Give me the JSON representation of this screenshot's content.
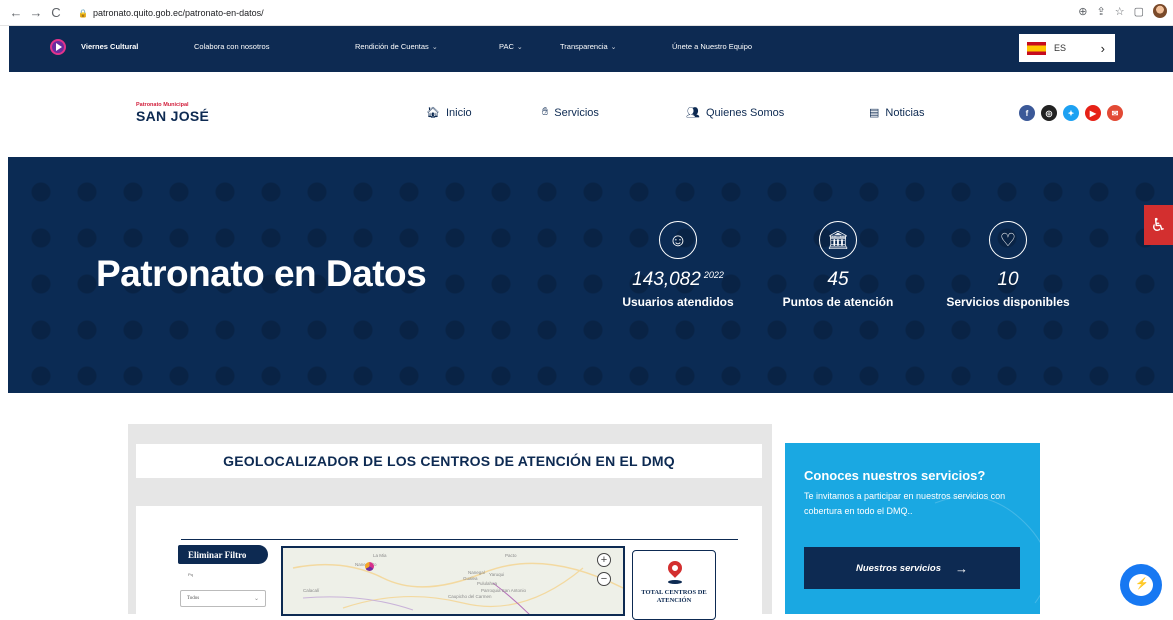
{
  "browser": {
    "url": "patronato.quito.gob.ec/patronato-en-datos/"
  },
  "topbar": {
    "items": [
      {
        "label": "Viernes Cultural"
      },
      {
        "label": "Colabora con nosotros"
      },
      {
        "label": "Rendición de Cuentas"
      },
      {
        "label": "PAC"
      },
      {
        "label": "Transparencia"
      },
      {
        "label": "Únete a Nuestro Equipo"
      }
    ],
    "language": {
      "code": "ES"
    }
  },
  "header": {
    "logo_small": "Patronato Municipal",
    "logo_big": "SAN JOSÉ",
    "nav": [
      {
        "label": "Inicio",
        "icon": "home-icon"
      },
      {
        "label": "Servicios",
        "icon": "hand-icon"
      },
      {
        "label": "Quienes Somos",
        "icon": "users-icon"
      },
      {
        "label": "Noticias",
        "icon": "newspaper-icon"
      }
    ],
    "social": [
      {
        "name": "facebook-icon",
        "glyph": "f",
        "color": "#3b5998"
      },
      {
        "name": "instagram-icon",
        "glyph": "◎",
        "color": "#222222"
      },
      {
        "name": "twitter-icon",
        "glyph": "✦",
        "color": "#1da1f2"
      },
      {
        "name": "youtube-icon",
        "glyph": "▶",
        "color": "#e62117"
      },
      {
        "name": "email-icon",
        "glyph": "✉",
        "color": "#e24a35"
      }
    ]
  },
  "hero": {
    "title": "Patronato en Datos",
    "stats": [
      {
        "value": "143,082",
        "suffix": "2022",
        "label": "Usuarios atendidos",
        "icon": "users-outline-icon"
      },
      {
        "value": "45",
        "suffix": "",
        "label": "Puntos de atención",
        "icon": "building-icon"
      },
      {
        "value": "10",
        "suffix": "",
        "label": "Servicios disponibles",
        "icon": "heart-icon"
      }
    ]
  },
  "geo": {
    "title": "GEOLOCALIZADOR DE LOS CENTROS DE ATENCIÓN EN EL DMQ",
    "filter_button": "Eliminar Filtro",
    "select_label": "Pq",
    "select_value": "Todos",
    "map_labels": [
      "La Mia",
      "Nanegalito",
      "Pacto",
      "Nanegal",
      "Yaruqui",
      "Gualea",
      "Pululahua",
      "Pululahua",
      "Parroquia San Antonio",
      "Calacalí",
      "Caupicho del Carmen"
    ],
    "total_label": "TOTAL CENTROS DE ATENCIÓN"
  },
  "services_card": {
    "title": "Conoces nuestros servicios?",
    "description": "Te invitamos a participar en nuestros servicios con cobertura en todo el DMQ..",
    "button": "Nuestros servicios"
  },
  "colors": {
    "navy": "#0d2a52",
    "cyan": "#1aa8e2",
    "accent_red": "#d32f2f"
  }
}
